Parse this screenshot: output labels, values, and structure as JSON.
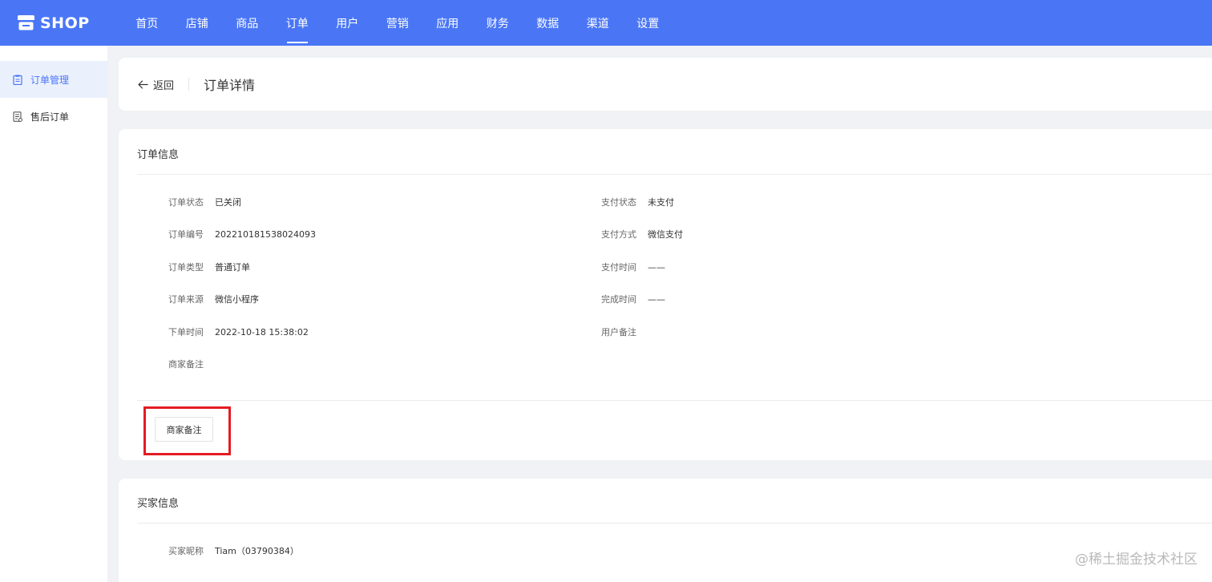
{
  "app": {
    "logo_text": "SHOP"
  },
  "nav": {
    "items": [
      {
        "label": "首页",
        "active": false
      },
      {
        "label": "店铺",
        "active": false
      },
      {
        "label": "商品",
        "active": false
      },
      {
        "label": "订单",
        "active": true
      },
      {
        "label": "用户",
        "active": false
      },
      {
        "label": "营销",
        "active": false
      },
      {
        "label": "应用",
        "active": false
      },
      {
        "label": "财务",
        "active": false
      },
      {
        "label": "数据",
        "active": false
      },
      {
        "label": "渠道",
        "active": false
      },
      {
        "label": "设置",
        "active": false
      }
    ]
  },
  "sidebar": {
    "items": [
      {
        "label": "订单管理",
        "icon": "clipboard-icon",
        "active": true
      },
      {
        "label": "售后订单",
        "icon": "receipt-icon",
        "active": false
      }
    ]
  },
  "header": {
    "back_label": "返回",
    "title": "订单详情"
  },
  "order_info": {
    "title": "订单信息",
    "left": [
      {
        "label": "订单状态",
        "value": "已关闭"
      },
      {
        "label": "订单编号",
        "value": "202210181538024093"
      },
      {
        "label": "订单类型",
        "value": "普通订单"
      },
      {
        "label": "订单来源",
        "value": "微信小程序"
      },
      {
        "label": "下单时间",
        "value": "2022-10-18 15:38:02"
      },
      {
        "label": "商家备注",
        "value": ""
      }
    ],
    "right": [
      {
        "label": "支付状态",
        "value": "未支付"
      },
      {
        "label": "支付方式",
        "value": "微信支付"
      },
      {
        "label": "支付时间",
        "value": "——"
      },
      {
        "label": "完成时间",
        "value": "——"
      },
      {
        "label": "用户备注",
        "value": ""
      }
    ],
    "remark_button": "商家备注"
  },
  "buyer_info": {
    "title": "买家信息",
    "nickname_label": "买家昵称",
    "nickname_value": "Tiam（03790384）"
  },
  "watermark": "@稀土掘金技术社区",
  "colors": {
    "primary": "#4a76f6",
    "highlight": "#e51b23"
  }
}
